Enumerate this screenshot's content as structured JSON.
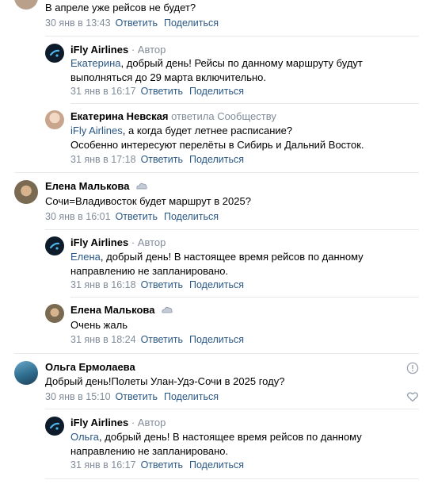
{
  "comments": [
    {
      "text": "В апреле уже рейсов не будет?",
      "date": "30 янв в 13:43",
      "reply": "Ответить",
      "share": "Поделиться"
    },
    {
      "author": "iFly Airlines",
      "role": "· Автор",
      "mention": "Екатерина",
      "text": ", добрый день! Рейсы по данному маршруту будут выполняться до 29 марта включительно.",
      "date": "31 янв в 16:17",
      "reply": "Ответить",
      "share": "Поделиться"
    },
    {
      "author": "Екатерина Невская",
      "replied_to": "ответила Сообществу",
      "mention": "iFly Airlines",
      "text": ", а когда будет летнее расписание?",
      "text2": "Особенно интересуют перелёты в Сибирь и Дальний Восток.",
      "date": "31 янв в 17:18",
      "reply": "Ответить",
      "share": "Поделиться"
    },
    {
      "author": "Елена Малькова",
      "text": "Сочи=Владивосток будет маршрут в 2025?",
      "date": "30 янв в 16:01",
      "reply": "Ответить",
      "share": "Поделиться"
    },
    {
      "author": "iFly Airlines",
      "role": "· Автор",
      "mention": "Елена",
      "text": ", добрый день! В настоящее время рейсов по данному направлению не запланировано.",
      "date": "31 янв в 16:18",
      "reply": "Ответить",
      "share": "Поделиться"
    },
    {
      "author": "Елена Малькова",
      "text": "Очень жаль",
      "date": "31 янв в 18:24",
      "reply": "Ответить",
      "share": "Поделиться"
    },
    {
      "author": "Ольга Ермолаева",
      "text": "Добрый день!Полеты Улан-Удэ-Сочи в 2025 году?",
      "date": "30 янв в 15:10",
      "reply": "Ответить",
      "share": "Поделиться"
    },
    {
      "author": "iFly Airlines",
      "role": "· Автор",
      "mention": "Ольга",
      "text": ", добрый день! В настоящее время рейсов по данному направлению не запланировано.",
      "date": "31 янв в 16:17",
      "reply": "Ответить",
      "share": "Поделиться"
    }
  ],
  "icons": {
    "report": "report-icon",
    "like": "heart-icon",
    "badge": "cloud-icon",
    "ifly_logo": "ifly-logo-icon"
  },
  "colors": {
    "link": "#2a5885",
    "meta": "#818c99",
    "divider": "#e7e8ec",
    "ifly_bg": "#0d1b2a"
  }
}
